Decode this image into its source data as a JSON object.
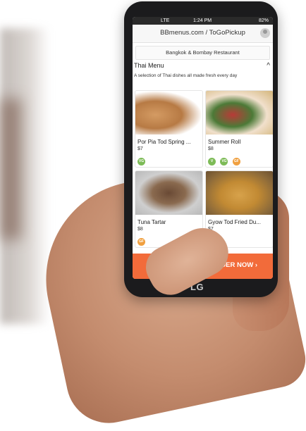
{
  "status_bar": {
    "network": "LTE",
    "time": "1:24 PM",
    "battery": "82%"
  },
  "app_bar": {
    "title": "BBmenus.com / ToGoPickup"
  },
  "restaurant_name": "Bangkok & Bombay Restaurant",
  "menu": {
    "title": "Thai Menu",
    "description": "A selection of Thai dishes all made fresh every day",
    "items": [
      {
        "name": "Por Pia Tod Spring ...",
        "price": "$7",
        "tags": [
          "VG"
        ]
      },
      {
        "name": "Summer Roll",
        "price": "$8",
        "tags": [
          "V",
          "VG",
          "GF"
        ]
      },
      {
        "name": "Tuna Tartar",
        "price": "$8",
        "tags": [
          "GF"
        ]
      },
      {
        "name": "Gyow Tod Fried Du...",
        "price": "$7",
        "tags": []
      }
    ]
  },
  "order_button": {
    "label": "DER NOW ›"
  },
  "phone_brand": "LG"
}
